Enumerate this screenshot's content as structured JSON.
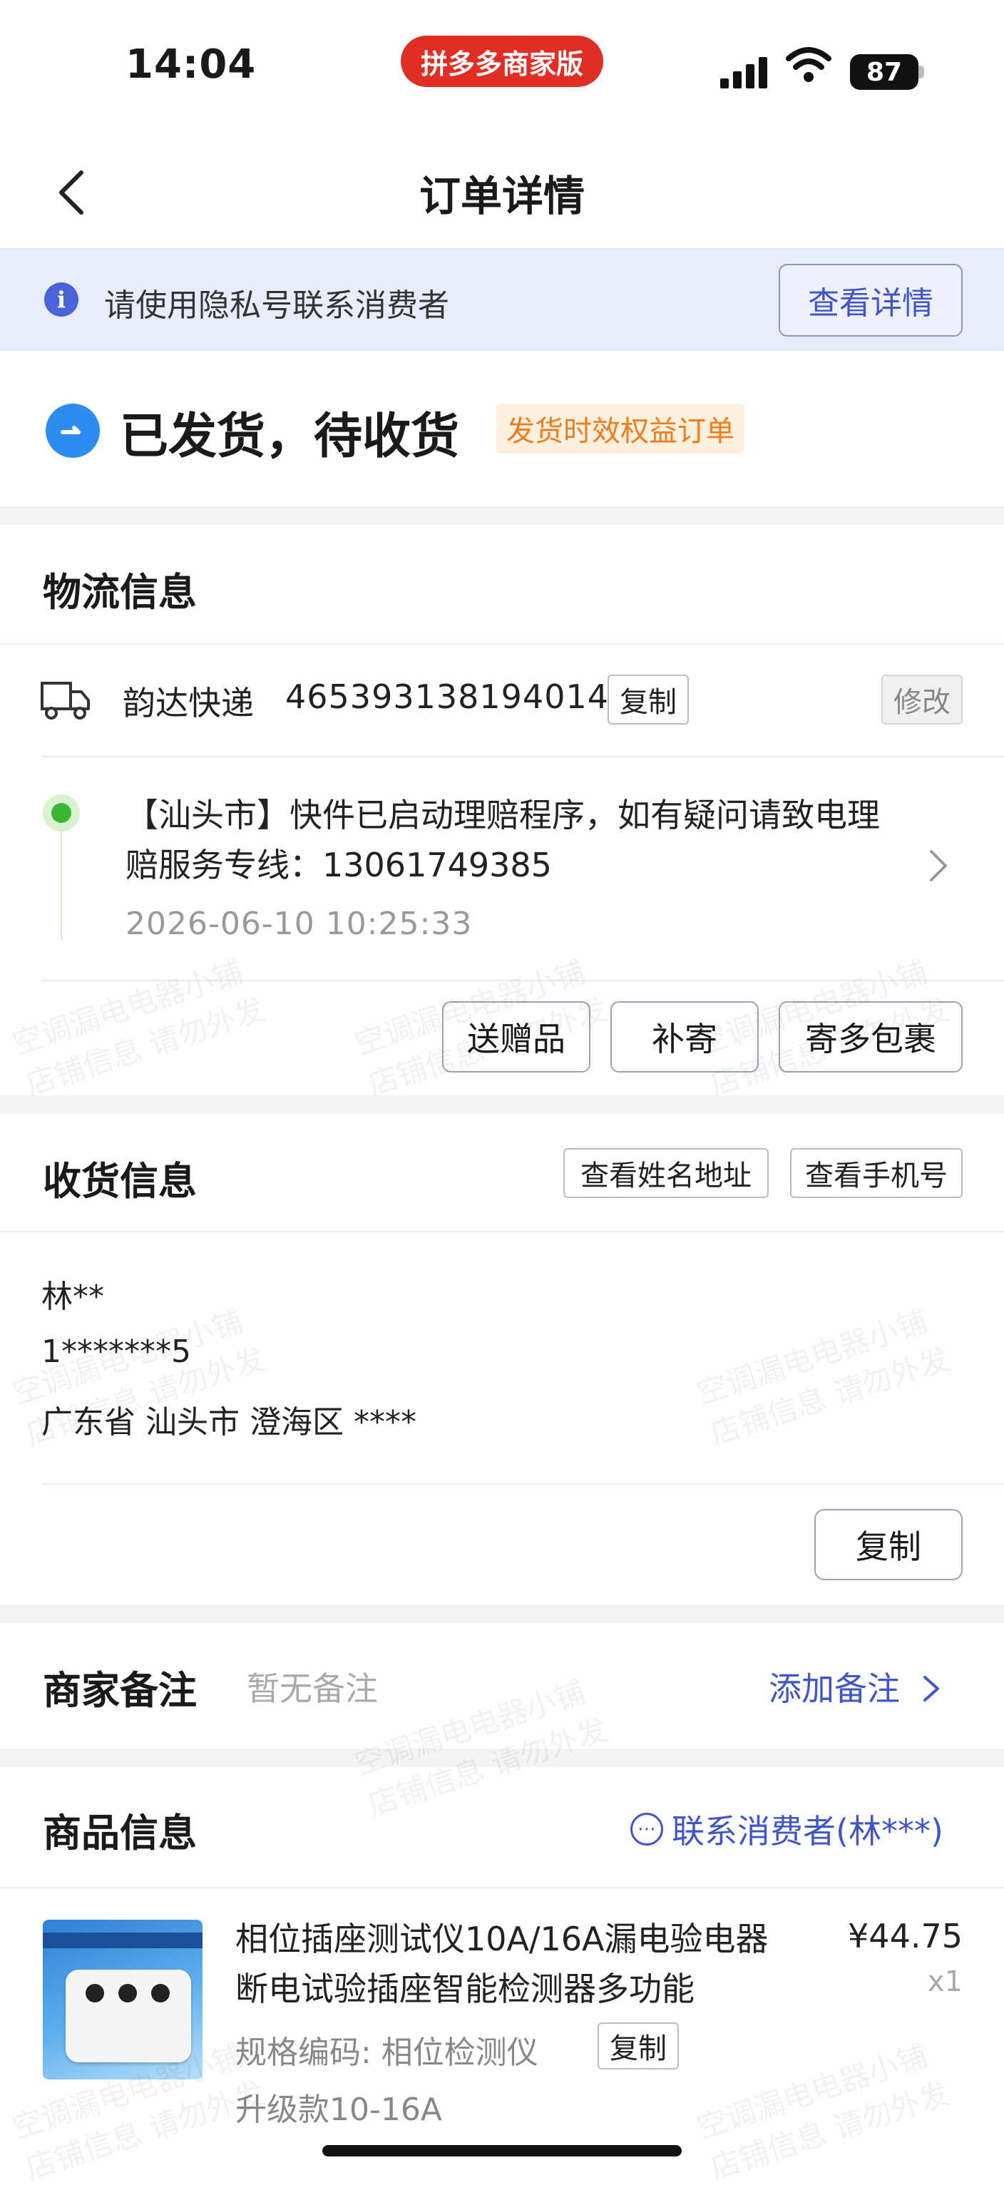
{
  "status_bar": {
    "time": "14:04",
    "app_badge": "拼多多商家版",
    "battery": "87"
  },
  "nav": {
    "title": "订单详情"
  },
  "privacy_banner": {
    "text": "请使用隐私号联系消费者",
    "button": "查看详情"
  },
  "order_status": {
    "text": "已发货，待收货",
    "tag": "发货时效权益订单"
  },
  "logistics": {
    "title": "物流信息",
    "carrier": "韵达快递",
    "tracking_number": "465393138194014",
    "copy_label": "复制",
    "modify_label": "修改",
    "latest_message": "【汕头市】快件已启动理赔程序，如有疑问请致电理赔服务专线：13061749385",
    "latest_time": "2026-06-10 10:25:33",
    "actions": [
      "送赠品",
      "补寄",
      "寄多包裹"
    ]
  },
  "receiver": {
    "title": "收货信息",
    "view_name_address": "查看姓名地址",
    "view_phone": "查看手机号",
    "name": "林**",
    "phone": "1*******5",
    "address": "广东省 汕头市 澄海区 ****",
    "copy_label": "复制"
  },
  "merchant_note": {
    "title": "商家备注",
    "empty_text": "暂无备注",
    "add_label": "添加备注"
  },
  "product": {
    "title": "商品信息",
    "contact_label": "联系消费者(林***)",
    "name": "相位插座测试仪10A/16A漏电验电器断电试验插座智能检测器多功能",
    "price": "¥44.75",
    "quantity": "x1",
    "spec_code": "规格编码: 相位检测仪",
    "spec_copy_label": "复制",
    "variant": "升级款10-16A"
  },
  "watermark": {
    "line1": "空调漏电电器小铺",
    "line2": "店铺信息 请勿外发"
  },
  "colors": {
    "accent": "#3f55c9",
    "status_blue": "#2d8cf0",
    "pdd_red": "#e02e24",
    "tag_orange": "#f07d1a",
    "timeline_green": "#3cb531"
  },
  "icons": [
    "back-arrow-icon",
    "info-icon",
    "shipped-status-icon",
    "truck-icon",
    "chevron-right-icon",
    "chat-icon",
    "signal-icon",
    "wifi-icon",
    "battery-icon"
  ]
}
